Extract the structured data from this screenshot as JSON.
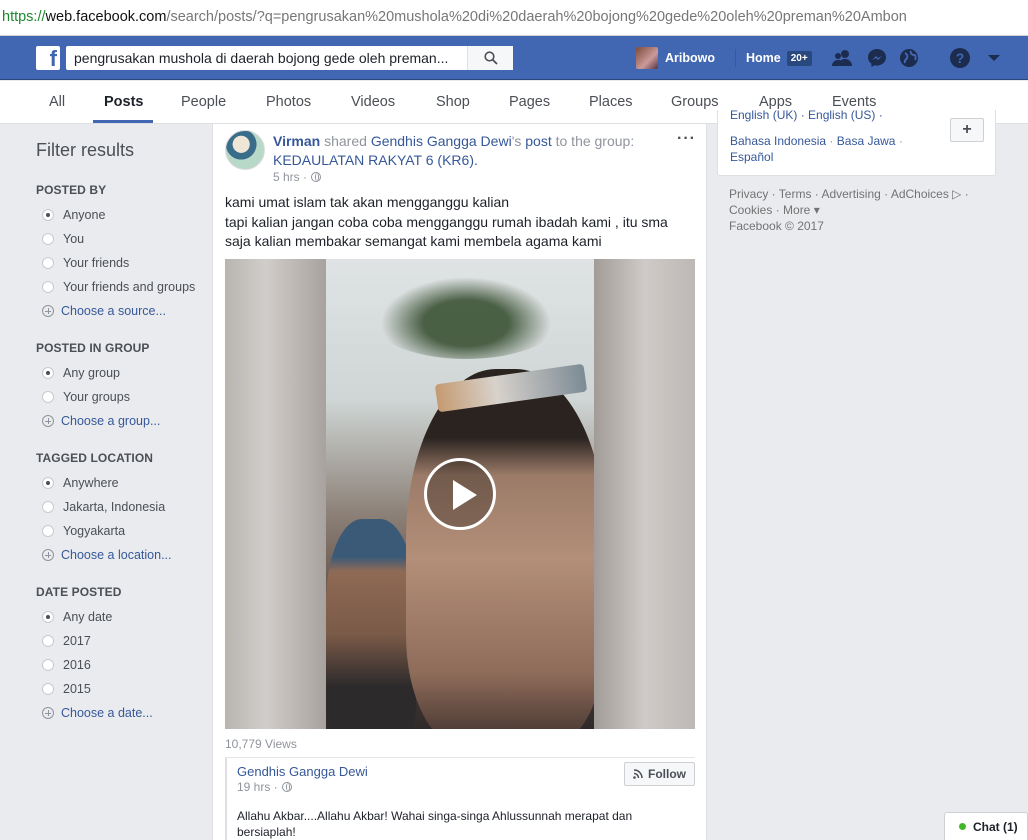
{
  "browser": {
    "url_scheme": "https://",
    "url_host": "web.facebook.com",
    "url_rest": "/search/posts/?q=pengrusakan%20mushola%20di%20daerah%20bojong%20gede%20oleh%20preman%20Ambon"
  },
  "topbar": {
    "logo": "f",
    "search_value": "pengrusakan mushola di daerah bojong gede oleh preman...",
    "user_name": "Aribowo",
    "home_label": "Home",
    "home_badge": "20+"
  },
  "tabs": [
    "All",
    "Posts",
    "People",
    "Photos",
    "Videos",
    "Shop",
    "Pages",
    "Places",
    "Groups",
    "Apps",
    "Events"
  ],
  "filters": {
    "title": "Filter results",
    "posted_by": {
      "title": "POSTED BY",
      "options": [
        "Anyone",
        "You",
        "Your friends",
        "Your friends and groups"
      ],
      "choose": "Choose a source..."
    },
    "posted_in_group": {
      "title": "POSTED IN GROUP",
      "options": [
        "Any group",
        "Your groups"
      ],
      "choose": "Choose a group..."
    },
    "tagged_location": {
      "title": "TAGGED LOCATION",
      "options": [
        "Anywhere",
        "Jakarta, Indonesia",
        "Yogyakarta"
      ],
      "choose": "Choose a location..."
    },
    "date_posted": {
      "title": "DATE POSTED",
      "options": [
        "Any date",
        "2017",
        "2016",
        "2015"
      ],
      "choose": "Choose a date..."
    }
  },
  "post": {
    "author": "Virman",
    "shared_word": " shared ",
    "source_name": "Gendhis Gangga Dewi",
    "source_suffix": "'s ",
    "post_word": "post",
    "to_group": " to the group: ",
    "group_name": "KEDAULATAN RAKYAT 6 (KR6).",
    "time": "5 hrs ·",
    "more": "···",
    "text_line1": "kami umat islam tak akan mengganggu kalian",
    "text_line2": "tapi kalian jangan coba coba mengganggu rumah ibadah kami , itu sma saja kalian membakar semangat kami membela agama kami",
    "views": "10,779 Views",
    "shared": {
      "name": "Gendhis Gangga Dewi",
      "time": "19 hrs ·",
      "follow": "Follow",
      "text": "Allahu Akbar....Allahu Akbar! Wahai singa-singa Ahlussunnah merapat dan bersiaplah!"
    }
  },
  "right": {
    "lang_top": "English (UK) · English (US) ·",
    "lang_1": "Bahasa Indonesia",
    "lang_2": "Basa Jawa",
    "lang_3": "Español",
    "plus": "+",
    "footer_line1": "Privacy · Terms · Advertising · AdChoices ▷ ·",
    "footer_line2": "Cookies · More ▾",
    "footer_line3": "Facebook © 2017"
  },
  "chat": {
    "label": "Chat (1)"
  },
  "colors": {
    "brand": "#4267b2",
    "link": "#365899",
    "online": "#42b72a"
  },
  "icons": [
    "search-icon",
    "friends-icon",
    "messenger-icon",
    "globe-icon",
    "help-icon",
    "caret-down-icon",
    "play-icon",
    "rss-icon"
  ]
}
